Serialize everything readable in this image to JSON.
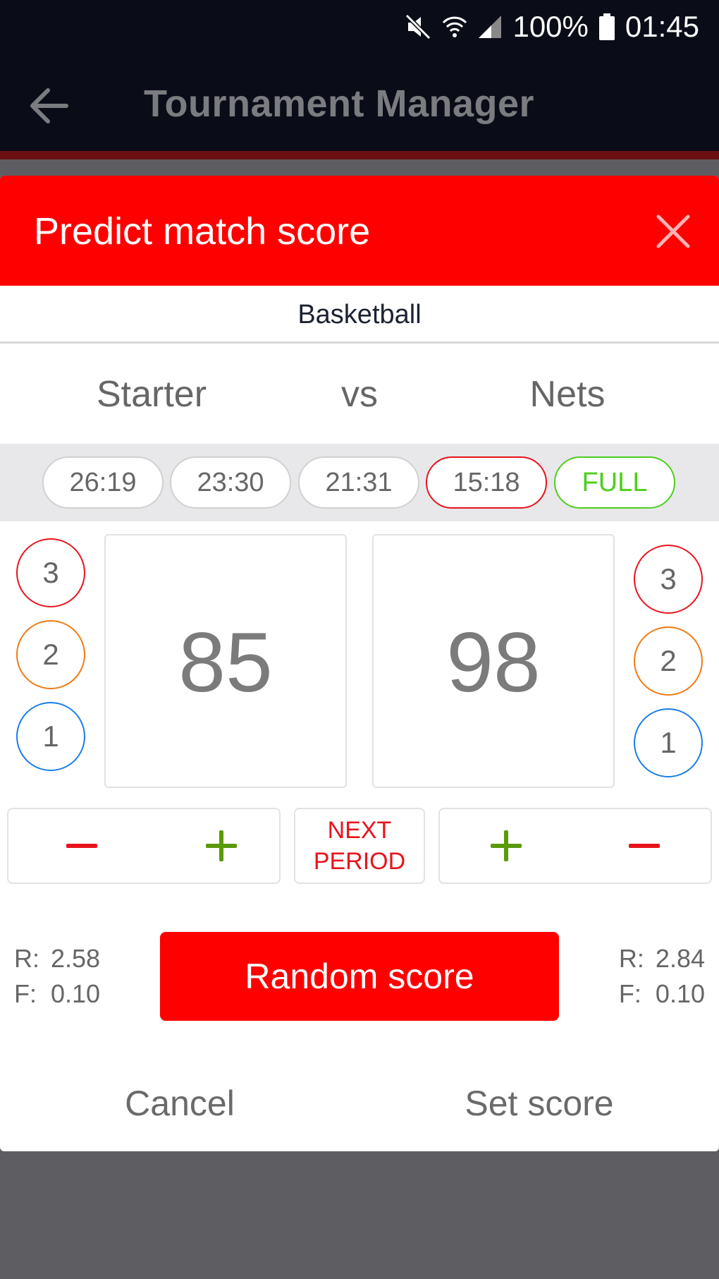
{
  "status_bar": {
    "battery": "100%",
    "time": "01:45",
    "icons": [
      "mute-icon",
      "wifi-icon",
      "signal-icon",
      "battery-icon"
    ]
  },
  "app_bar": {
    "title": "Tournament Manager",
    "back_icon": "arrow-left-icon"
  },
  "dialog": {
    "title": "Predict match score",
    "close_icon": "close-icon",
    "sport": "Basketball",
    "home_team": "Starter",
    "vs": "vs",
    "away_team": "Nets",
    "periods": [
      {
        "label": "26:19",
        "state": "normal"
      },
      {
        "label": "23:30",
        "state": "normal"
      },
      {
        "label": "21:31",
        "state": "normal"
      },
      {
        "label": "15:18",
        "state": "active"
      },
      {
        "label": "FULL",
        "state": "full"
      }
    ],
    "point_buttons": [
      "3",
      "2",
      "1"
    ],
    "home_score": "85",
    "away_score": "98",
    "next_period_line1": "NEXT",
    "next_period_line2": "PERIOD",
    "home_stats": {
      "r_label": "R:",
      "r_value": "2.58",
      "f_label": "F:",
      "f_value": "0.10"
    },
    "away_stats": {
      "r_label": "R:",
      "r_value": "2.84",
      "f_label": "F:",
      "f_value": "0.10"
    },
    "random_label": "Random score",
    "cancel_label": "Cancel",
    "set_label": "Set score"
  },
  "colors": {
    "accent": "#ff0000",
    "three_points": "#e8141c",
    "two_points": "#f07a14",
    "one_point": "#1a7de8",
    "full_period": "#4ccf1c",
    "plus": "#5a9a0a"
  }
}
